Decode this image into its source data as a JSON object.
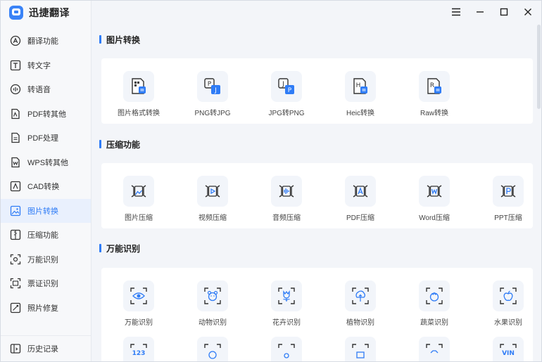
{
  "app": {
    "name": "迅捷翻译"
  },
  "sidebar": {
    "items": [
      {
        "label": "翻译功能",
        "icon": "translate-icon"
      },
      {
        "label": "转文字",
        "icon": "text-icon"
      },
      {
        "label": "转语音",
        "icon": "voice-icon"
      },
      {
        "label": "PDF转其他",
        "icon": "pdf-convert-icon"
      },
      {
        "label": "PDF处理",
        "icon": "pdf-process-icon"
      },
      {
        "label": "WPS转其他",
        "icon": "wps-icon"
      },
      {
        "label": "CAD转换",
        "icon": "cad-icon"
      },
      {
        "label": "图片转换",
        "icon": "image-convert-icon",
        "active": true
      },
      {
        "label": "压缩功能",
        "icon": "compress-icon"
      },
      {
        "label": "万能识别",
        "icon": "recognize-icon"
      },
      {
        "label": "票证识别",
        "icon": "ticket-icon"
      },
      {
        "label": "照片修复",
        "icon": "photo-repair-icon"
      }
    ],
    "history": {
      "label": "历史记录",
      "icon": "history-icon"
    }
  },
  "sections": {
    "image_convert": {
      "title": "图片转换",
      "tools": [
        {
          "label": "图片格式转换",
          "icon": "image-format-icon"
        },
        {
          "label": "PNG转JPG",
          "icon": "png-to-jpg-icon"
        },
        {
          "label": "JPG转PNG",
          "icon": "jpg-to-png-icon"
        },
        {
          "label": "Heic转换",
          "icon": "heic-icon"
        },
        {
          "label": "Raw转换",
          "icon": "raw-icon"
        }
      ]
    },
    "compress": {
      "title": "压缩功能",
      "tools": [
        {
          "label": "图片压缩",
          "icon": "image-compress-icon"
        },
        {
          "label": "视频压缩",
          "icon": "video-compress-icon"
        },
        {
          "label": "音频压缩",
          "icon": "audio-compress-icon"
        },
        {
          "label": "PDF压缩",
          "icon": "pdf-compress-icon"
        },
        {
          "label": "Word压缩",
          "icon": "word-compress-icon"
        },
        {
          "label": "PPT压缩",
          "icon": "ppt-compress-icon"
        }
      ]
    },
    "recognize": {
      "title": "万能识别",
      "tools": [
        {
          "label": "万能识别",
          "icon": "eye-icon"
        },
        {
          "label": "动物识别",
          "icon": "animal-icon"
        },
        {
          "label": "花卉识别",
          "icon": "flower-icon"
        },
        {
          "label": "植物识别",
          "icon": "plant-icon"
        },
        {
          "label": "蔬菜识别",
          "icon": "vegetable-icon"
        },
        {
          "label": "水果识别",
          "icon": "fruit-icon"
        }
      ],
      "partial_row_glyphs": [
        "123",
        "VIN"
      ]
    }
  },
  "colors": {
    "accent": "#2f7cf6",
    "sidebar_bg": "#f7f8fa",
    "content_bg": "#f3f5f9"
  }
}
